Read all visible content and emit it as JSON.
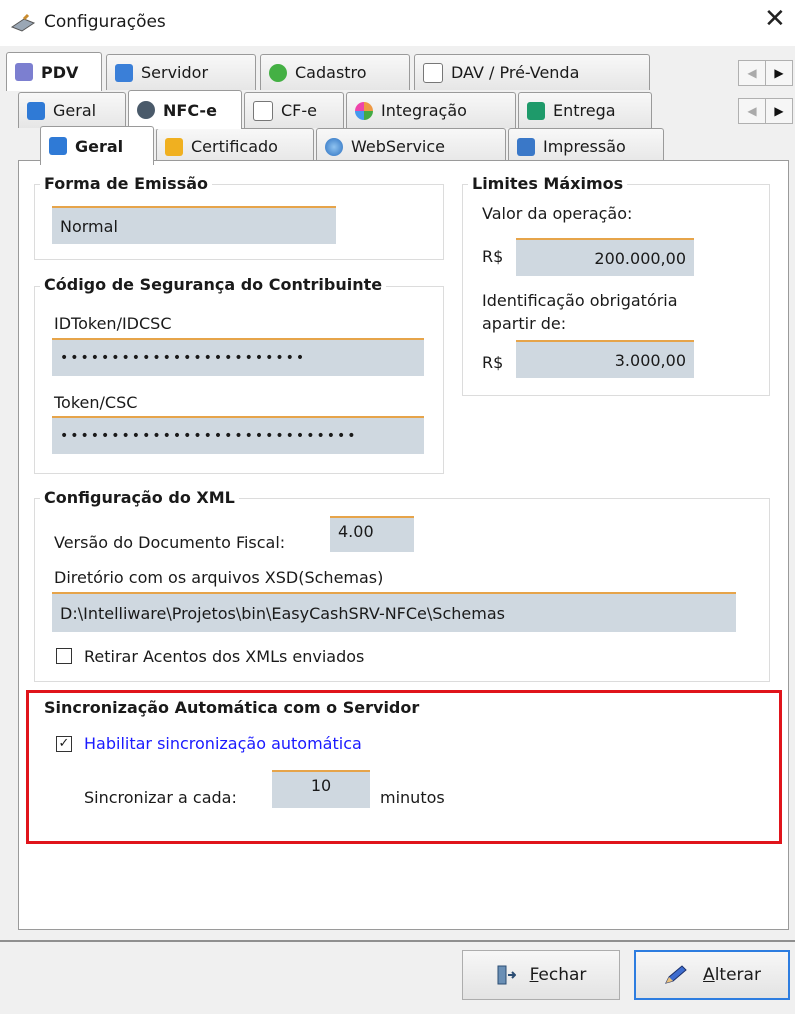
{
  "window": {
    "title": "Configurações",
    "close_glyph": "✕"
  },
  "tabs_row1": [
    {
      "label": "PDV",
      "icon": "pdv-icon",
      "active": true
    },
    {
      "label": "Servidor",
      "icon": "server-icon"
    },
    {
      "label": "Cadastro",
      "icon": "add-icon"
    },
    {
      "label": "DAV / Pré-Venda",
      "icon": "document-icon"
    }
  ],
  "tabs_row2": [
    {
      "label": "Geral",
      "icon": "general-icon"
    },
    {
      "label": "NFC-e",
      "icon": "nfce-icon",
      "active": true
    },
    {
      "label": "CF-e",
      "icon": "document-icon"
    },
    {
      "label": "Integração",
      "icon": "integration-icon"
    },
    {
      "label": "Entrega",
      "icon": "delivery-icon"
    }
  ],
  "tabs_row3": [
    {
      "label": "Geral",
      "icon": "general-icon",
      "active": true
    },
    {
      "label": "Certificado",
      "icon": "certificate-icon"
    },
    {
      "label": "WebService",
      "icon": "globe-icon"
    },
    {
      "label": "Impressão",
      "icon": "printer-icon"
    }
  ],
  "scroll": {
    "left": "◀",
    "right": "▶"
  },
  "forma_emissao": {
    "title": "Forma de Emissão",
    "value": "Normal"
  },
  "codigo_seguranca": {
    "title": "Código de Segurança do Contribuinte",
    "idtoken_label": "IDToken/IDCSC",
    "idtoken_value": "••••••••••••••••••••••••",
    "token_label": "Token/CSC",
    "token_value": "•••••••••••••••••••••••••••••"
  },
  "limites": {
    "title": "Limites Máximos",
    "valor_label": "Valor da operação:",
    "currency": "R$",
    "valor_value": "200.000,00",
    "ident_label_1": "Identificação obrigatória",
    "ident_label_2": "apartir de:",
    "ident_value": "3.000,00"
  },
  "xml": {
    "title": "Configuração do XML",
    "versao_label": "Versão do Documento Fiscal:",
    "versao_value": "4.00",
    "diretorio_label": "Diretório com os arquivos XSD(Schemas)",
    "diretorio_value": "D:\\Intelliware\\Projetos\\bin\\EasyCashSRV-NFCe\\Schemas",
    "retirar_label": "Retirar Acentos dos XMLs enviados",
    "retirar_checked": false
  },
  "sync": {
    "title": "Sincronização Automática com o Servidor",
    "habilitar_label": "Habilitar sincronização automática",
    "habilitar_checked": true,
    "check_glyph": "✓",
    "intervalo_label": "Sincronizar a cada:",
    "intervalo_value": "10",
    "unit": "minutos"
  },
  "buttons": {
    "fechar_prefix": "",
    "fechar_accel": "F",
    "fechar_rest": "echar",
    "alterar_accel": "A",
    "alterar_rest": "lterar"
  },
  "colors": {
    "accent_orange": "#e6a44a",
    "field_bg": "#cfd8e0",
    "highlight_red": "#e0141b",
    "link_blue": "#1a1aff"
  }
}
